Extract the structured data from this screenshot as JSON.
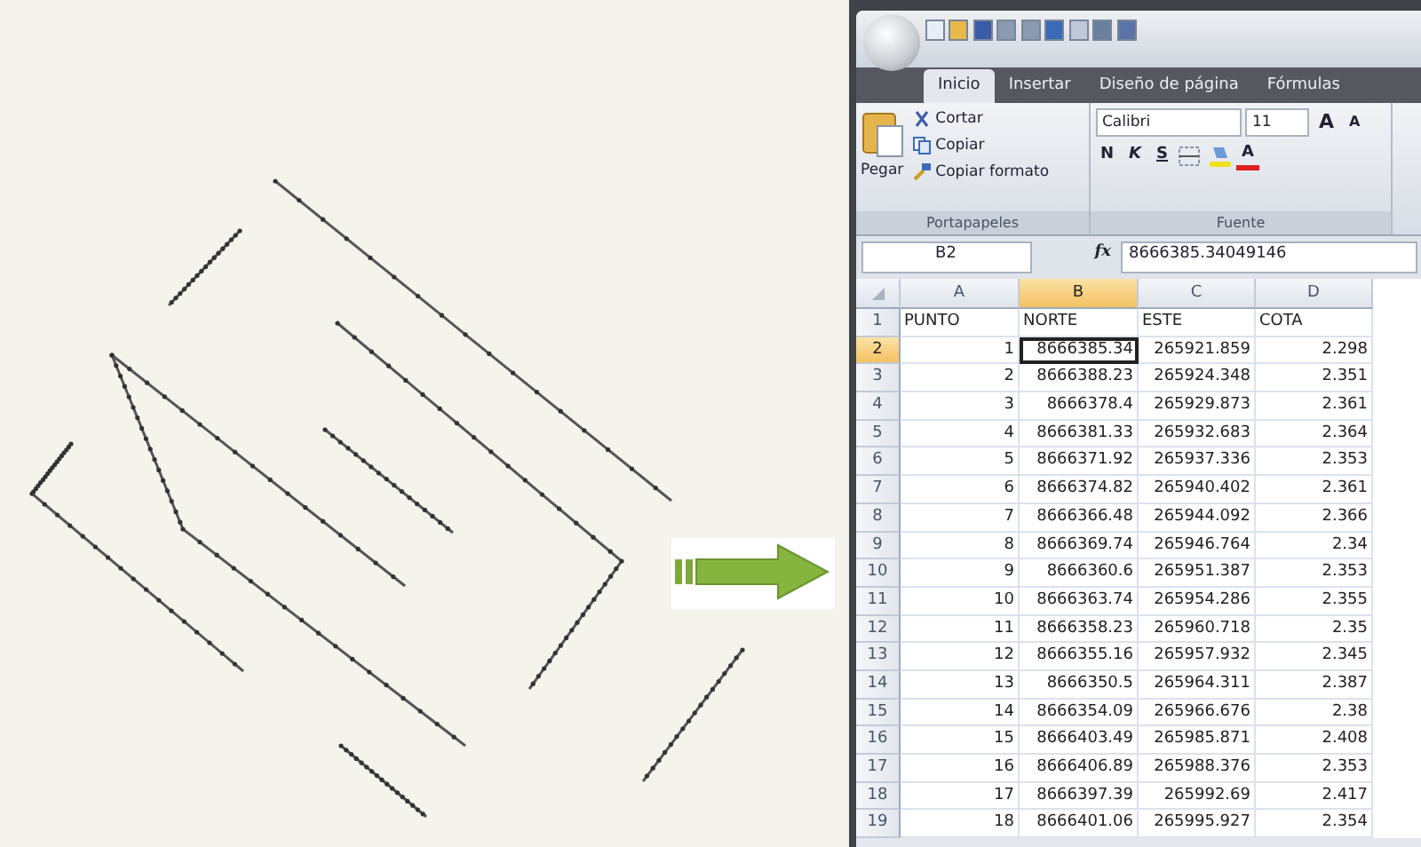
{
  "tabs": [
    {
      "label": "Inicio",
      "selected": true
    },
    {
      "label": "Insertar",
      "selected": false
    },
    {
      "label": "Diseño de página",
      "selected": false
    },
    {
      "label": "Fórmulas",
      "selected": false
    }
  ],
  "clipboard": {
    "paste_label": "Pegar",
    "items": [
      "Cortar",
      "Copiar",
      "Copiar formato"
    ],
    "title": "Portapapeles"
  },
  "font": {
    "font_name": "Calibri",
    "font_size": "11",
    "grow": "A",
    "shrink": "A",
    "bold": "N",
    "italic": "K",
    "underline": "S",
    "font_color": "A",
    "title": "Fuente"
  },
  "formula_bar": {
    "name_box": "B2",
    "function_label": "fx",
    "value": "8666385.34049146"
  },
  "sheet": {
    "columns": [
      {
        "label": "A",
        "selected": false
      },
      {
        "label": "B",
        "selected": true
      },
      {
        "label": "C",
        "selected": false
      },
      {
        "label": "D",
        "selected": false
      }
    ],
    "rows": [
      {
        "number": "1",
        "kind": "header",
        "selected": false,
        "cells": [
          "PUNTO",
          "NORTE",
          "ESTE",
          "COTA"
        ]
      },
      {
        "number": "2",
        "kind": "data",
        "selected": true,
        "cells": [
          "1",
          "8666385.34",
          "265921.859",
          "2.298"
        ]
      },
      {
        "number": "3",
        "kind": "data",
        "selected": false,
        "cells": [
          "2",
          "8666388.23",
          "265924.348",
          "2.351"
        ]
      },
      {
        "number": "4",
        "kind": "data",
        "selected": false,
        "cells": [
          "3",
          "8666378.4",
          "265929.873",
          "2.361"
        ]
      },
      {
        "number": "5",
        "kind": "data",
        "selected": false,
        "cells": [
          "4",
          "8666381.33",
          "265932.683",
          "2.364"
        ]
      },
      {
        "number": "6",
        "kind": "data",
        "selected": false,
        "cells": [
          "5",
          "8666371.92",
          "265937.336",
          "2.353"
        ]
      },
      {
        "number": "7",
        "kind": "data",
        "selected": false,
        "cells": [
          "6",
          "8666374.82",
          "265940.402",
          "2.361"
        ]
      },
      {
        "number": "8",
        "kind": "data",
        "selected": false,
        "cells": [
          "7",
          "8666366.48",
          "265944.092",
          "2.366"
        ]
      },
      {
        "number": "9",
        "kind": "data",
        "selected": false,
        "cells": [
          "8",
          "8666369.74",
          "265946.764",
          "2.34"
        ]
      },
      {
        "number": "10",
        "kind": "data",
        "selected": false,
        "cells": [
          "9",
          "8666360.6",
          "265951.387",
          "2.353"
        ]
      },
      {
        "number": "11",
        "kind": "data",
        "selected": false,
        "cells": [
          "10",
          "8666363.74",
          "265954.286",
          "2.355"
        ]
      },
      {
        "number": "12",
        "kind": "data",
        "selected": false,
        "cells": [
          "11",
          "8666358.23",
          "265960.718",
          "2.35"
        ]
      },
      {
        "number": "13",
        "kind": "data",
        "selected": false,
        "cells": [
          "12",
          "8666355.16",
          "265957.932",
          "2.345"
        ]
      },
      {
        "number": "14",
        "kind": "data",
        "selected": false,
        "cells": [
          "13",
          "8666350.5",
          "265964.311",
          "2.387"
        ]
      },
      {
        "number": "15",
        "kind": "data",
        "selected": false,
        "cells": [
          "14",
          "8666354.09",
          "265966.676",
          "2.38"
        ]
      },
      {
        "number": "16",
        "kind": "data",
        "selected": false,
        "cells": [
          "15",
          "8666403.49",
          "265985.871",
          "2.408"
        ]
      },
      {
        "number": "17",
        "kind": "data",
        "selected": false,
        "cells": [
          "16",
          "8666406.89",
          "265988.376",
          "2.353"
        ]
      },
      {
        "number": "18",
        "kind": "data",
        "selected": false,
        "cells": [
          "17",
          "8666397.39",
          "265992.69",
          "2.417"
        ]
      },
      {
        "number": "19",
        "kind": "data",
        "selected": false,
        "cells": [
          "18",
          "8666401.06",
          "265995.927",
          "2.354"
        ]
      }
    ]
  }
}
